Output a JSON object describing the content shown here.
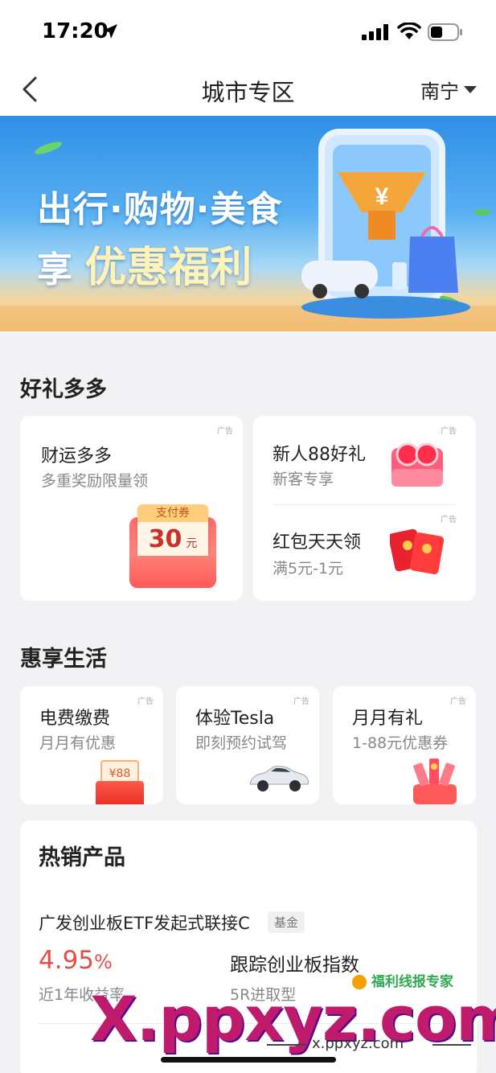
{
  "status": {
    "time": "17:20"
  },
  "nav": {
    "title": "城市专区",
    "city": "南宁"
  },
  "banner": {
    "line1": "出行·购物·美食",
    "line2_prefix": "享",
    "line2_highlight": "优惠福利"
  },
  "gifts": {
    "title": "好礼多多",
    "ad_tag": "广告",
    "big": {
      "title": "财运多多",
      "subtitle": "多重奖励限量领",
      "coupon_label": "支付券",
      "coupon_value": "30",
      "coupon_unit": "元"
    },
    "small": [
      {
        "title": "新人88好礼",
        "subtitle": "新客专享"
      },
      {
        "title": "红包天天领",
        "subtitle": "满5元-1元"
      }
    ]
  },
  "life": {
    "title": "惠享生活",
    "ad_tag": "广告",
    "cards": [
      {
        "title": "电费缴费",
        "subtitle": "月月有优惠",
        "art_text": "¥88"
      },
      {
        "title": "体验Tesla",
        "subtitle": "即刻预约试驾"
      },
      {
        "title": "月月有礼",
        "subtitle": "1-88元优惠券"
      }
    ]
  },
  "hot": {
    "title": "热销产品",
    "product": {
      "name": "广发创业板ETF发起式联接C",
      "badge": "基金",
      "rate": "4.95",
      "rate_unit": "%",
      "rate_label": "近1年收益率",
      "track": "跟踪创业板指数",
      "risk": "5R进取型"
    }
  },
  "watermark": {
    "logo": "福利线报专家",
    "big": "X.ppxyz.com",
    "small": "x.ppxyz.com"
  },
  "colors": {
    "accent_red": "#e84b4b",
    "bg": "#f2f2f4"
  }
}
